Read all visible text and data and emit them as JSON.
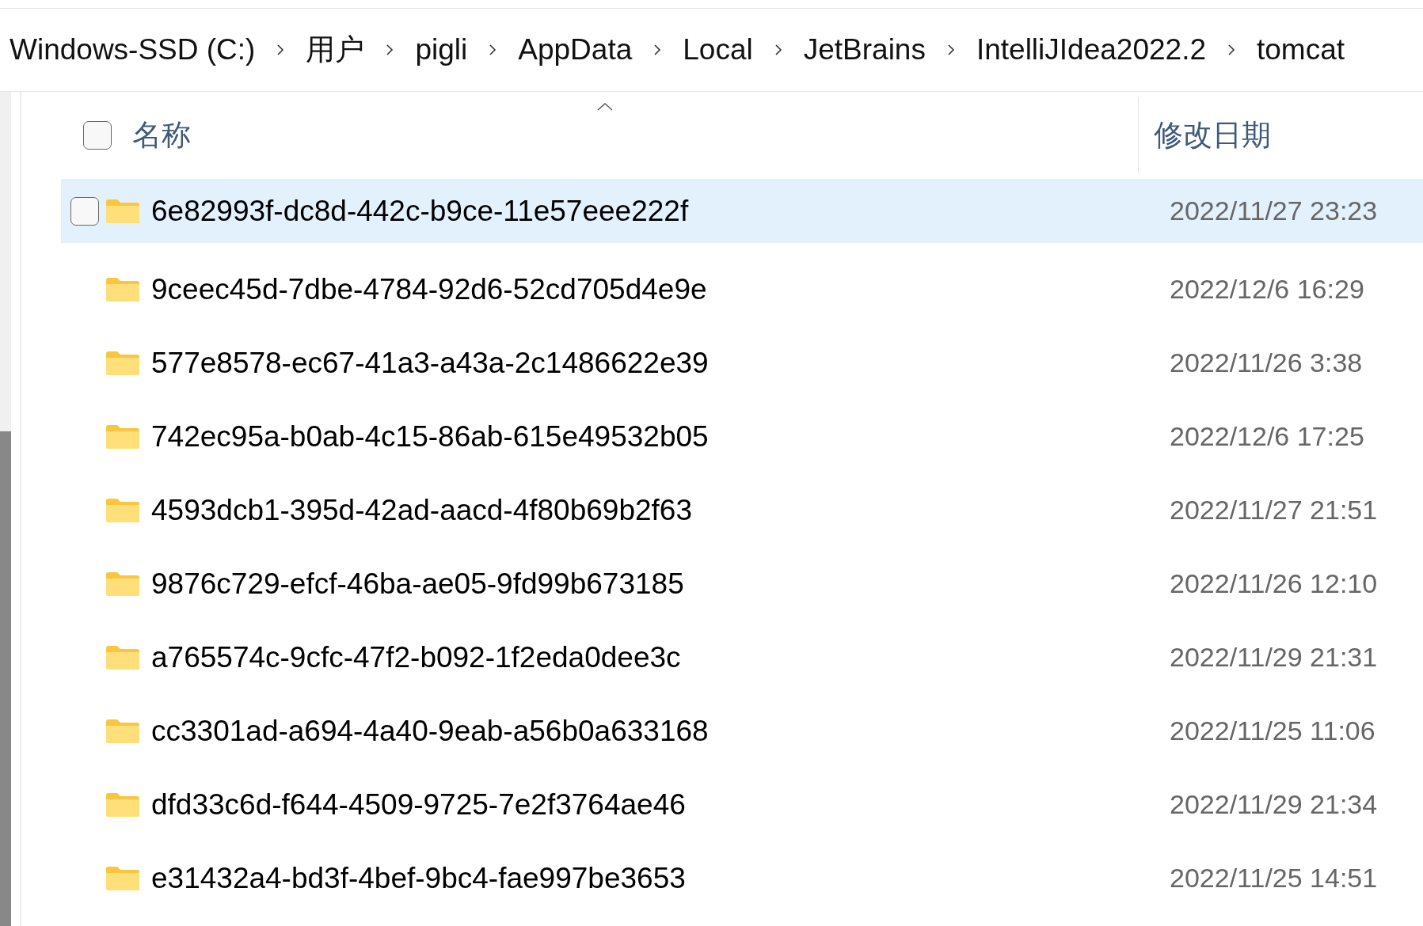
{
  "breadcrumb": [
    "Windows-SSD (C:)",
    "用户",
    "pigli",
    "AppData",
    "Local",
    "JetBrains",
    "IntelliJIdea2022.2",
    "tomcat"
  ],
  "header": {
    "checked": false,
    "columns": [
      "名称",
      "修改日期"
    ]
  },
  "rows": [
    {
      "name": "6e82993f-dc8d-442c-b9ce-11e57eee222f",
      "date": "2022/11/27 23:23",
      "selected": true
    },
    {
      "name": "9ceec45d-7dbe-4784-92d6-52cd705d4e9e",
      "date": "2022/12/6 16:29",
      "selected": false
    },
    {
      "name": "577e8578-ec67-41a3-a43a-2c1486622e39",
      "date": "2022/11/26 3:38",
      "selected": false
    },
    {
      "name": "742ec95a-b0ab-4c15-86ab-615e49532b05",
      "date": "2022/12/6 17:25",
      "selected": false
    },
    {
      "name": "4593dcb1-395d-42ad-aacd-4f80b69b2f63",
      "date": "2022/11/27 21:51",
      "selected": false
    },
    {
      "name": "9876c729-efcf-46ba-ae05-9fd99b673185",
      "date": "2022/11/26 12:10",
      "selected": false
    },
    {
      "name": "a765574c-9cfc-47f2-b092-1f2eda0dee3c",
      "date": "2022/11/29 21:31",
      "selected": false
    },
    {
      "name": "cc3301ad-a694-4a40-9eab-a56b0a633168",
      "date": "2022/11/25 11:06",
      "selected": false
    },
    {
      "name": "dfd33c6d-f644-4509-9725-7e2f3764ae46",
      "date": "2022/11/29 21:34",
      "selected": false
    },
    {
      "name": "e31432a4-bd3f-4bef-9bc4-fae997be3653",
      "date": "2022/11/25 14:51",
      "selected": false
    }
  ]
}
